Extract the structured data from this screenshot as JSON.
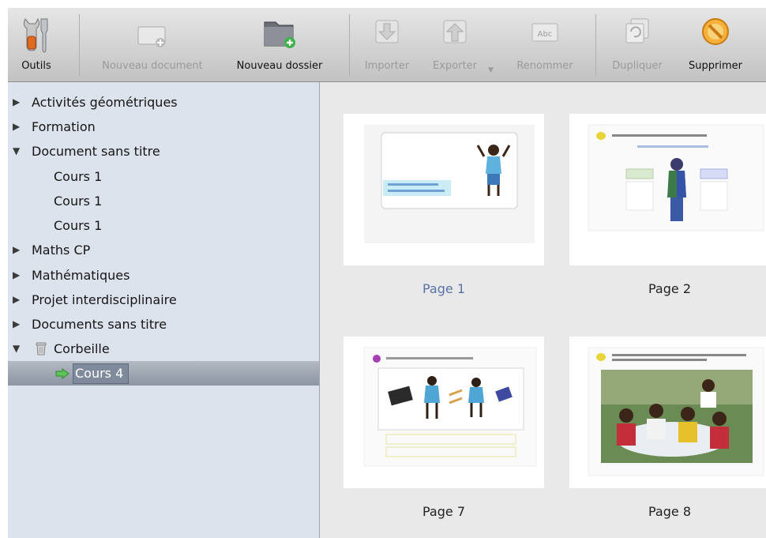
{
  "toolbar": {
    "tools": "Outils",
    "new_document": "Nouveau document",
    "new_folder": "Nouveau dossier",
    "import": "Importer",
    "export": "Exporter",
    "rename": "Renommer",
    "rename_icon_text": "Abc",
    "duplicate": "Dupliquer",
    "delete": "Supprimer"
  },
  "sidebar": {
    "items": [
      {
        "label": "Activités géométriques"
      },
      {
        "label": "Formation"
      },
      {
        "label": "Document sans titre"
      },
      {
        "label": "Cours 1"
      },
      {
        "label": "Cours 1"
      },
      {
        "label": "Cours 1"
      },
      {
        "label": "Maths CP"
      },
      {
        "label": "Mathématiques"
      },
      {
        "label": "Projet interdisciplinaire"
      },
      {
        "label": "Documents sans titre"
      },
      {
        "label": "Corbeille"
      },
      {
        "label": "Cours 4"
      }
    ]
  },
  "pages": [
    {
      "label": "Page 1",
      "selected": true
    },
    {
      "label": "Page 2",
      "selected": false
    },
    {
      "label": "Page 7",
      "selected": false
    },
    {
      "label": "Page 8",
      "selected": false
    }
  ]
}
